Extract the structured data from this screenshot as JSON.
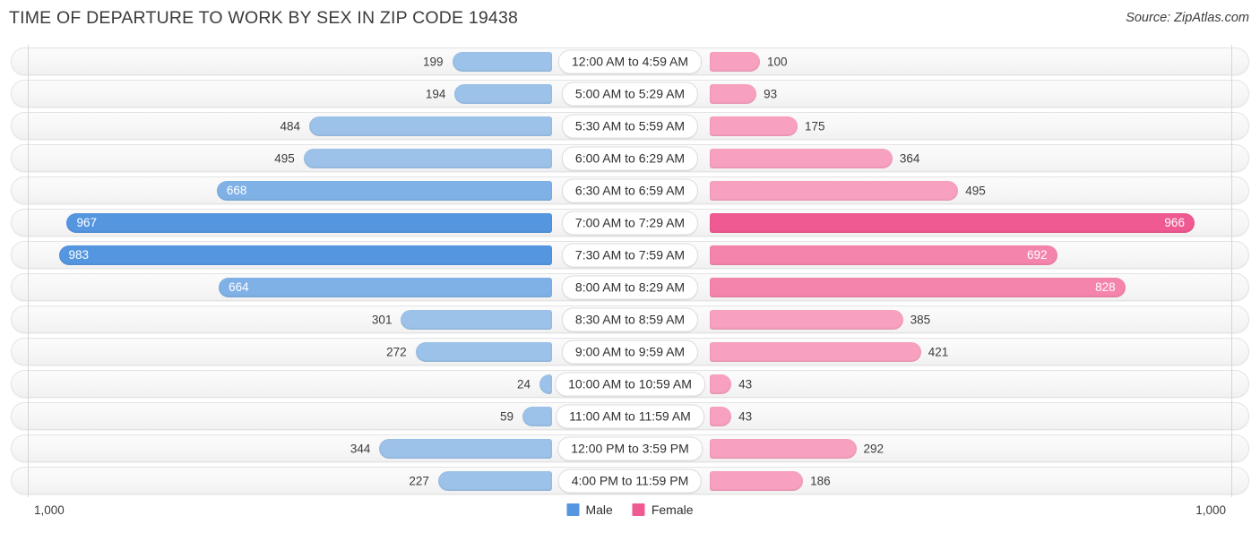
{
  "header": {
    "title": "TIME OF DEPARTURE TO WORK BY SEX IN ZIP CODE 19438",
    "source": "Source: ZipAtlas.com"
  },
  "footer": {
    "axis_left": "1,000",
    "axis_right": "1,000",
    "legend": [
      {
        "label": "Male",
        "color": "#5596e0"
      },
      {
        "label": "Female",
        "color": "#ee5a91"
      }
    ]
  },
  "colors": {
    "male_light": "#9cc2ea",
    "male_mid": "#7fb1e6",
    "male_dark": "#5596e0",
    "female_light": "#f7a0c0",
    "female_mid": "#f484ac",
    "female_dark": "#ee5a91",
    "row_background": "#f7f7f7",
    "row_border": "#e3e3e3",
    "axis_line": "#d6d6d6"
  },
  "chart_data": {
    "type": "bar",
    "subtype": "diverging-bidirectional",
    "title": "TIME OF DEPARTURE TO WORK BY SEX IN ZIP CODE 19438",
    "xlabel": "",
    "ylabel": "",
    "xlim": [
      1000,
      1000
    ],
    "axis_max": 1000,
    "grid": false,
    "legend_position": "bottom-center",
    "categories": [
      "12:00 AM to 4:59 AM",
      "5:00 AM to 5:29 AM",
      "5:30 AM to 5:59 AM",
      "6:00 AM to 6:29 AM",
      "6:30 AM to 6:59 AM",
      "7:00 AM to 7:29 AM",
      "7:30 AM to 7:59 AM",
      "8:00 AM to 8:29 AM",
      "8:30 AM to 8:59 AM",
      "9:00 AM to 9:59 AM",
      "10:00 AM to 10:59 AM",
      "11:00 AM to 11:59 AM",
      "12:00 PM to 3:59 PM",
      "4:00 PM to 11:59 PM"
    ],
    "series": [
      {
        "name": "Male",
        "color": "#5596e0",
        "direction": "left",
        "values": [
          199,
          194,
          484,
          495,
          668,
          967,
          983,
          664,
          301,
          272,
          24,
          59,
          344,
          227
        ]
      },
      {
        "name": "Female",
        "color": "#ee5a91",
        "direction": "right",
        "values": [
          100,
          93,
          175,
          364,
          495,
          966,
          692,
          828,
          385,
          421,
          43,
          43,
          292,
          186
        ]
      }
    ]
  },
  "rows": [
    {
      "label": "12:00 AM to 4:59 AM",
      "male": "199",
      "female": "100",
      "male_inside": false,
      "female_inside": false
    },
    {
      "label": "5:00 AM to 5:29 AM",
      "male": "194",
      "female": "93",
      "male_inside": false,
      "female_inside": false
    },
    {
      "label": "5:30 AM to 5:59 AM",
      "male": "484",
      "female": "175",
      "male_inside": false,
      "female_inside": false
    },
    {
      "label": "6:00 AM to 6:29 AM",
      "male": "495",
      "female": "364",
      "male_inside": false,
      "female_inside": false
    },
    {
      "label": "6:30 AM to 6:59 AM",
      "male": "668",
      "female": "495",
      "male_inside": true,
      "female_inside": false
    },
    {
      "label": "7:00 AM to 7:29 AM",
      "male": "967",
      "female": "966",
      "male_inside": true,
      "female_inside": true
    },
    {
      "label": "7:30 AM to 7:59 AM",
      "male": "983",
      "female": "692",
      "male_inside": true,
      "female_inside": true
    },
    {
      "label": "8:00 AM to 8:29 AM",
      "male": "664",
      "female": "828",
      "male_inside": true,
      "female_inside": true
    },
    {
      "label": "8:30 AM to 8:59 AM",
      "male": "301",
      "female": "385",
      "male_inside": false,
      "female_inside": false
    },
    {
      "label": "9:00 AM to 9:59 AM",
      "male": "272",
      "female": "421",
      "male_inside": false,
      "female_inside": false
    },
    {
      "label": "10:00 AM to 10:59 AM",
      "male": "24",
      "female": "43",
      "male_inside": false,
      "female_inside": false
    },
    {
      "label": "11:00 AM to 11:59 AM",
      "male": "59",
      "female": "43",
      "male_inside": false,
      "female_inside": false
    },
    {
      "label": "12:00 PM to 3:59 PM",
      "male": "344",
      "female": "292",
      "male_inside": false,
      "female_inside": false
    },
    {
      "label": "4:00 PM to 11:59 PM",
      "male": "227",
      "female": "186",
      "male_inside": false,
      "female_inside": false
    }
  ]
}
